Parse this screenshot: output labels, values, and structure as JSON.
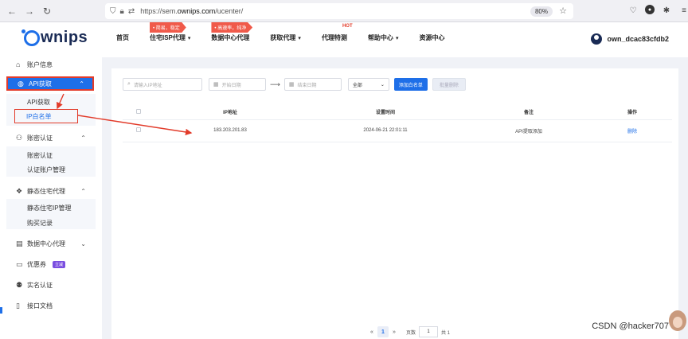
{
  "browser": {
    "url_prefix": "https://sem.",
    "url_domain": "ownips.com",
    "url_path": "/ucenter/",
    "zoom": "80%"
  },
  "header": {
    "logo": "wnips",
    "nav": [
      {
        "label": "首页"
      },
      {
        "label": "住宅ISP代理",
        "promo": "• 简易，稳定"
      },
      {
        "label": "数据中心代理",
        "promo": "• 高速率，纯净"
      },
      {
        "label": "获取代理"
      },
      {
        "label": "代理特测",
        "badge": "HOT"
      },
      {
        "label": "帮助中心"
      },
      {
        "label": "资源中心"
      }
    ],
    "username": "own_dcac83cfdb2"
  },
  "sidebar": {
    "account_info": "账户信息",
    "api_get": "API获取",
    "api_get_sub": "API获取",
    "ip_whitelist": "IP白名单",
    "account_auth": "账密认证",
    "account_auth_sub": "账密认证",
    "auth_account_manage": "认证账户管理",
    "static_residential": "静态住宅代理",
    "static_ip_manage": "静态住宅IP管理",
    "purchase_record": "购买记录",
    "datacenter_proxy": "数据中心代理",
    "coupon": "优惠券",
    "coupon_tag": "立减",
    "real_name": "实名认证",
    "api_docs": "接口文档"
  },
  "filters": {
    "ip_placeholder": "请输入IP地址",
    "start_date": "开始日期",
    "end_date": "结束日期",
    "select_value": "全部",
    "add_button": "添加白名单",
    "batch_delete": "批量删除"
  },
  "table": {
    "headers": [
      "IP地址",
      "设置时间",
      "备注",
      "操作"
    ],
    "rows": [
      {
        "ip": "183.203.201.83",
        "time": "2024-06-21 22:01:11",
        "note": "API提取添加",
        "action": "删除"
      }
    ]
  },
  "pager": {
    "prev": "«",
    "current": "1",
    "next": "»",
    "page_label": "页数",
    "page_value": "1",
    "total": "共 1"
  },
  "watermark": "CSDN @hacker707"
}
